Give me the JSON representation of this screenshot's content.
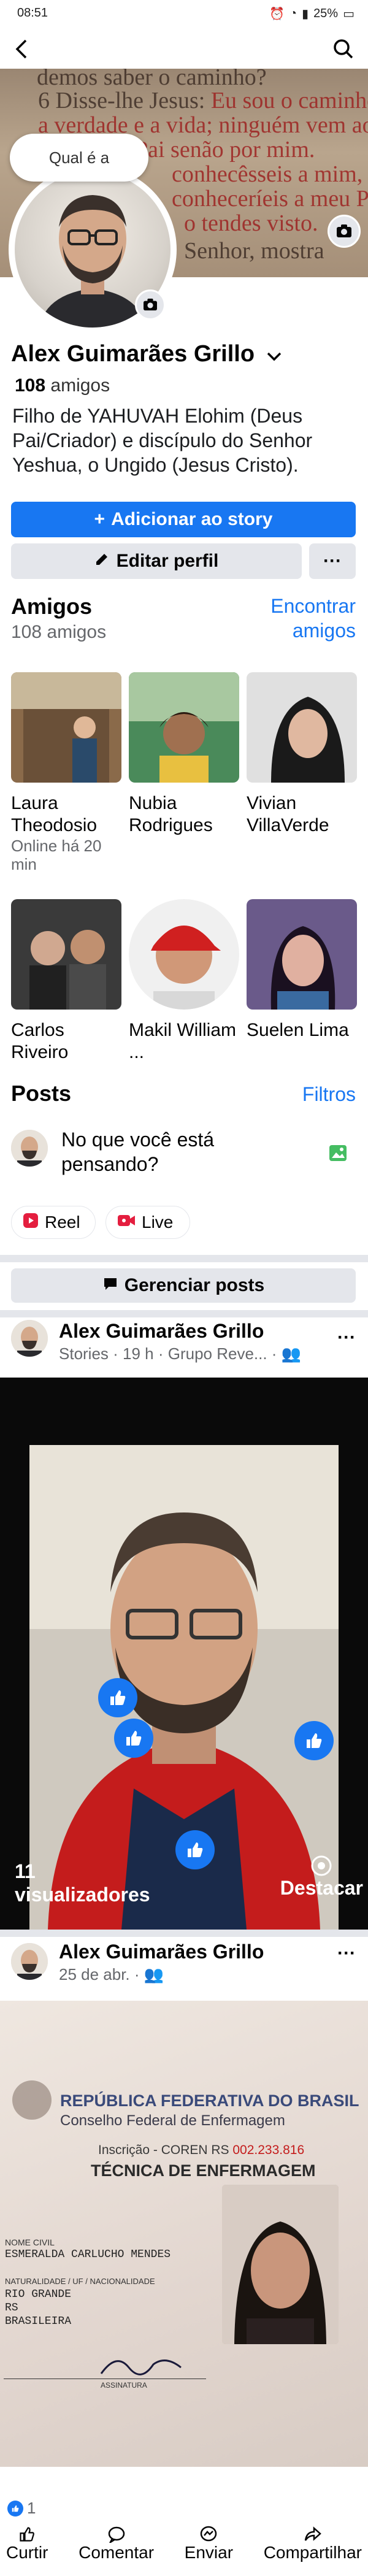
{
  "status_bar": {
    "time": "08:51",
    "battery": "25%"
  },
  "profile": {
    "name": "Alex Guimarães Grillo",
    "friends_count": "108",
    "friends_word": "amigos",
    "bio": "Filho de YAHUVAH Elohim (Deus Pai/Criador) e discípulo do Senhor Yeshua, o Ungido (Jesus Cristo).",
    "thought_bubble": "Qual é a"
  },
  "cover_text": {
    "l1": "demos saber o caminho?",
    "l2a": "6 Disse-lhe Jesus: ",
    "l2b": "Eu sou o caminho,",
    "l3": "a verdade e a vida; ninguém vem ao",
    "l4": "Pai senão por mim.",
    "l5": "conhecêsseis a mim, tam-",
    "l6": "conheceríeis a meu Pai; e já desde",
    "l7": "o tendes visto.",
    "l8": "Senhor, mostra"
  },
  "buttons": {
    "add_story": "Adicionar ao story",
    "edit_profile": "Editar perfil",
    "more": "···",
    "manage_posts": "Gerenciar posts"
  },
  "friends_section": {
    "title": "Amigos",
    "subtitle": "108 amigos",
    "find_link": "Encontrar amigos",
    "friends": [
      {
        "name": "Laura Theodosio",
        "sub": "Online há 20 min"
      },
      {
        "name": "Nubia Rodrigues",
        "sub": ""
      },
      {
        "name": "Vivian VillaVerde",
        "sub": ""
      },
      {
        "name": "Carlos Riveiro",
        "sub": ""
      },
      {
        "name": "Makil William ...",
        "sub": ""
      },
      {
        "name": "Suelen Lima",
        "sub": ""
      }
    ]
  },
  "posts_section": {
    "title": "Posts",
    "filter_link": "Filtros",
    "composer_placeholder": "No que você está pensando?",
    "reel": "Reel",
    "live": "Live"
  },
  "post1": {
    "author": "Alex Guimarães Grillo",
    "meta": "Stories · 19 h · Grupo Reve... ·",
    "views_count": "11",
    "views_label": "visualizadores",
    "highlight": "Destacar"
  },
  "post2": {
    "author": "Alex Guimarães Grillo",
    "date": "25 de abr. ·",
    "doc": {
      "country": "REPÚBLICA FEDERATIVA DO BRASIL",
      "council": "Conselho Federal de Enfermagem",
      "inscricao": "Inscrição - COREN RS ",
      "inscricao_num": "002.233.816",
      "role": "TÉCNICA DE ENFERMAGEM",
      "nome_label": "NOME CIVIL",
      "nome": "ESMERALDA CARLUCHO MENDES",
      "nat_label": "NATURALIDADE / UF / NACIONALIDADE",
      "nat1": "RIO GRANDE",
      "nat2": "RS",
      "nat3": "BRASILEIRA",
      "sign_label": "ASSINATURA"
    },
    "reactions": "1",
    "actions": [
      "Curtir",
      "Comentar",
      "Enviar",
      "Compartilhar"
    ]
  },
  "colors": {
    "accent": "#1877f2",
    "secondary_button": "#e4e6eb",
    "live_red": "#e41e3f"
  }
}
